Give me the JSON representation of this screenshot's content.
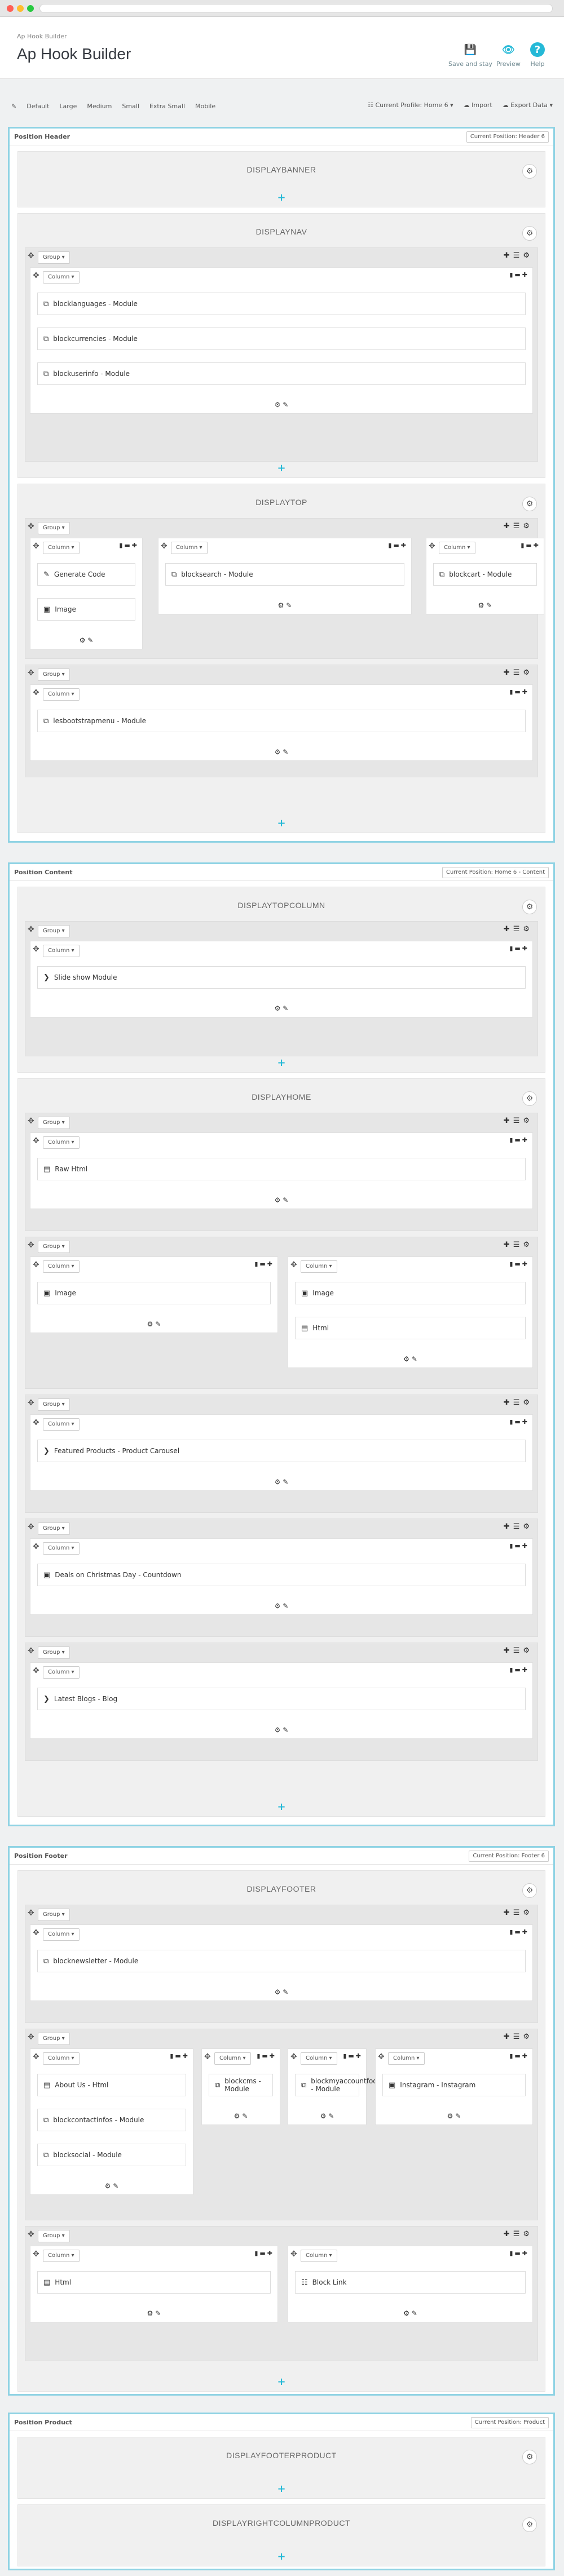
{
  "window": {
    "traffic_colors": [
      "#ff5f56",
      "#ffbd2e",
      "#27c93f"
    ]
  },
  "header": {
    "breadcrumb": "Ap Hook Builder",
    "title": "Ap Hook Builder",
    "save_label": "Save and stay",
    "preview_label": "Preview",
    "help_label": "Help",
    "accent": "#25b9d7"
  },
  "toolbar": {
    "devices": [
      "Default",
      "Large",
      "Medium",
      "Small",
      "Extra Small",
      "Mobile"
    ],
    "profile_label": "Current Profile: Home 6",
    "import_label": "Import",
    "export_label": "Export Data"
  },
  "positions": [
    {
      "title": "Position Header",
      "dropdown": "Current Position: Header 6",
      "hooks": [
        {
          "title": "DISPLAYBANNER",
          "groups": []
        },
        {
          "title": "DISPLAYNAV",
          "groups": [
            {
              "columns": [
                {
                  "modules": [
                    {
                      "icon": "module",
                      "label": "blocklanguages - Module"
                    },
                    {
                      "icon": "module",
                      "label": "blockcurrencies - Module"
                    },
                    {
                      "icon": "module",
                      "label": "blockuserinfo - Module"
                    }
                  ]
                }
              ]
            }
          ]
        },
        {
          "title": "DISPLAYTOP",
          "groups": [
            {
              "columns": [
                {
                  "modules": [
                    {
                      "icon": "edit",
                      "label": "Generate Code"
                    },
                    {
                      "icon": "image",
                      "label": "Image"
                    }
                  ]
                },
                {
                  "modules": [
                    {
                      "icon": "module",
                      "label": "blocksearch - Module"
                    }
                  ]
                },
                {
                  "modules": [
                    {
                      "icon": "module",
                      "label": "blockcart - Module"
                    }
                  ]
                }
              ]
            },
            {
              "columns": [
                {
                  "modules": [
                    {
                      "icon": "module",
                      "label": "lesbootstrapmenu - Module"
                    }
                  ]
                }
              ]
            }
          ]
        }
      ]
    },
    {
      "title": "Position Content",
      "dropdown": "Current Position: Home 6 - Content",
      "hooks": [
        {
          "title": "DISPLAYTOPCOLUMN",
          "groups": [
            {
              "columns": [
                {
                  "modules": [
                    {
                      "icon": "chevron",
                      "label": "Slide show Module"
                    }
                  ]
                }
              ]
            }
          ]
        },
        {
          "title": "DISPLAYHOME",
          "groups": [
            {
              "columns": [
                {
                  "modules": [
                    {
                      "icon": "html",
                      "label": "Raw Html"
                    }
                  ]
                }
              ]
            },
            {
              "columns": [
                {
                  "modules": [
                    {
                      "icon": "image",
                      "label": "Image"
                    }
                  ]
                },
                {
                  "modules": [
                    {
                      "icon": "image",
                      "label": "Image"
                    },
                    {
                      "icon": "html",
                      "label": "Html"
                    }
                  ]
                }
              ]
            },
            {
              "columns": [
                {
                  "modules": [
                    {
                      "icon": "chevron",
                      "label": "Featured Products - Product Carousel"
                    }
                  ]
                }
              ]
            },
            {
              "columns": [
                {
                  "modules": [
                    {
                      "icon": "image",
                      "label": "Deals on Christmas Day - Countdown"
                    }
                  ]
                }
              ]
            },
            {
              "columns": [
                {
                  "modules": [
                    {
                      "icon": "chevron",
                      "label": "Latest Blogs - Blog"
                    }
                  ]
                }
              ]
            }
          ]
        }
      ]
    },
    {
      "title": "Position Footer",
      "dropdown": "Current Position: Footer 6",
      "hooks": [
        {
          "title": "DISPLAYFOOTER",
          "groups": [
            {
              "columns": [
                {
                  "modules": [
                    {
                      "icon": "module",
                      "label": "blocknewsletter - Module"
                    }
                  ]
                }
              ]
            },
            {
              "columns": [
                {
                  "modules": [
                    {
                      "icon": "html",
                      "label": "About Us - Html"
                    },
                    {
                      "icon": "module",
                      "label": "blockcontactinfos - Module"
                    },
                    {
                      "icon": "module",
                      "label": "blocksocial - Module"
                    }
                  ]
                },
                {
                  "modules": [
                    {
                      "icon": "module",
                      "label": "blockcms - Module"
                    }
                  ]
                },
                {
                  "modules": [
                    {
                      "icon": "module",
                      "label": "blockmyaccountfooter - Module"
                    }
                  ]
                },
                {
                  "modules": [
                    {
                      "icon": "image",
                      "label": "Instagram - Instagram"
                    }
                  ]
                }
              ]
            },
            {
              "columns": [
                {
                  "modules": [
                    {
                      "icon": "html",
                      "label": "Html"
                    }
                  ]
                },
                {
                  "modules": [
                    {
                      "icon": "link",
                      "label": "Block Link"
                    }
                  ]
                }
              ]
            }
          ]
        }
      ]
    },
    {
      "title": "Position Product",
      "dropdown": "Current Position: Product",
      "hooks": [
        {
          "title": "DISPLAYFOOTERPRODUCT",
          "groups": []
        },
        {
          "title": "DISPLAYRIGHTCOLUMNPRODUCT",
          "groups": []
        }
      ]
    }
  ],
  "labels": {
    "group": "Group",
    "column": "Column"
  }
}
